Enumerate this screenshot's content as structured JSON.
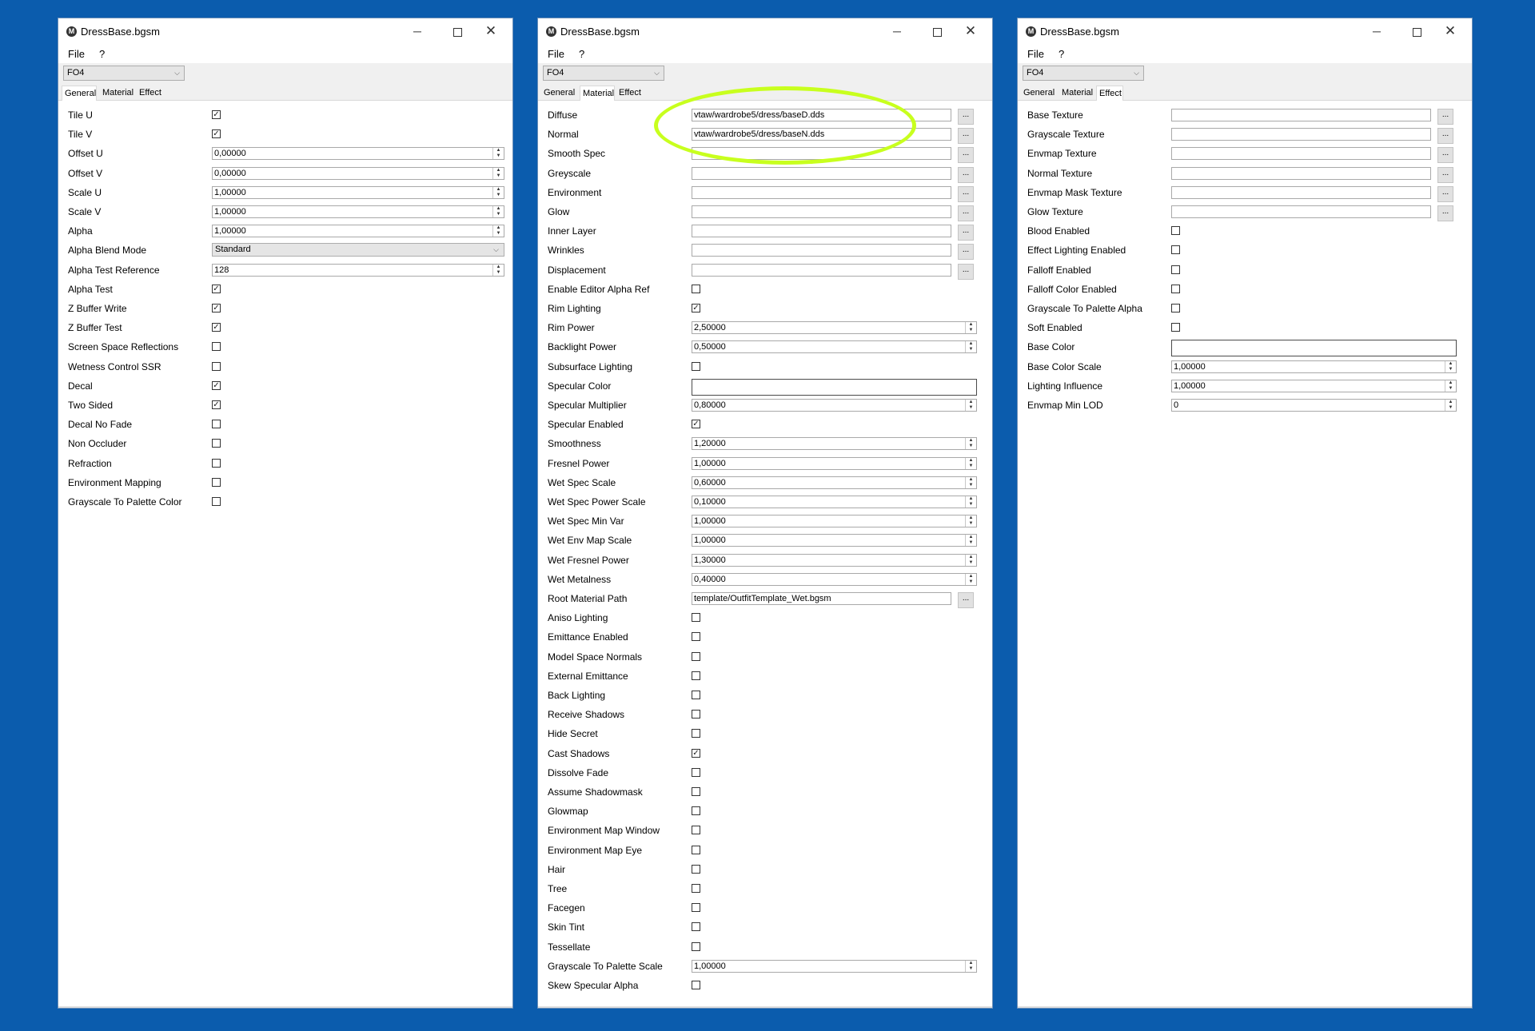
{
  "colors": {
    "desktop": "#0b5cad",
    "highlight": "#c8ff1e"
  },
  "windows": [
    {
      "title": "DressBase.bgsm",
      "icon": "M",
      "menu": [
        "File",
        "?"
      ],
      "game": "FO4",
      "tabs": [
        "General",
        "Material",
        "Effect"
      ],
      "active_tab": 0,
      "rows": [
        {
          "label": "Tile U",
          "type": "check",
          "checked": true
        },
        {
          "label": "Tile V",
          "type": "check",
          "checked": true
        },
        {
          "label": "Offset U",
          "type": "spin",
          "value": "0,00000"
        },
        {
          "label": "Offset V",
          "type": "spin",
          "value": "0,00000"
        },
        {
          "label": "Scale U",
          "type": "spin",
          "value": "1,00000"
        },
        {
          "label": "Scale V",
          "type": "spin",
          "value": "1,00000"
        },
        {
          "label": "Alpha",
          "type": "spin",
          "value": "1,00000"
        },
        {
          "label": "Alpha Blend Mode",
          "type": "select",
          "value": "Standard"
        },
        {
          "label": "Alpha Test Reference",
          "type": "spin",
          "value": "128"
        },
        {
          "label": "Alpha Test",
          "type": "check",
          "checked": true
        },
        {
          "label": "Z Buffer Write",
          "type": "check",
          "checked": true
        },
        {
          "label": "Z Buffer Test",
          "type": "check",
          "checked": true
        },
        {
          "label": "Screen Space Reflections",
          "type": "check",
          "checked": false
        },
        {
          "label": "Wetness Control SSR",
          "type": "check",
          "checked": false
        },
        {
          "label": "Decal",
          "type": "check",
          "checked": true
        },
        {
          "label": "Two Sided",
          "type": "check",
          "checked": true
        },
        {
          "label": "Decal No Fade",
          "type": "check",
          "checked": false
        },
        {
          "label": "Non Occluder",
          "type": "check",
          "checked": false
        },
        {
          "label": "Refraction",
          "type": "check",
          "checked": false
        },
        {
          "label": "Environment Mapping",
          "type": "check",
          "checked": false
        },
        {
          "label": "Grayscale To Palette Color",
          "type": "check",
          "checked": false
        }
      ]
    },
    {
      "title": "DressBase.bgsm",
      "icon": "M",
      "menu": [
        "File",
        "?"
      ],
      "game": "FO4",
      "tabs": [
        "General",
        "Material",
        "Effect"
      ],
      "active_tab": 1,
      "rows": [
        {
          "label": "Diffuse",
          "type": "path",
          "value": "vtaw/wardrobe5/dress/baseD.dds"
        },
        {
          "label": "Normal",
          "type": "path",
          "value": "vtaw/wardrobe5/dress/baseN.dds"
        },
        {
          "label": "Smooth Spec",
          "type": "path",
          "value": ""
        },
        {
          "label": "Greyscale",
          "type": "path",
          "value": ""
        },
        {
          "label": "Environment",
          "type": "path",
          "value": ""
        },
        {
          "label": "Glow",
          "type": "path",
          "value": ""
        },
        {
          "label": "Inner Layer",
          "type": "path",
          "value": ""
        },
        {
          "label": "Wrinkles",
          "type": "path",
          "value": ""
        },
        {
          "label": "Displacement",
          "type": "path",
          "value": ""
        },
        {
          "label": "Enable Editor Alpha Ref",
          "type": "check",
          "checked": false
        },
        {
          "label": "Rim Lighting",
          "type": "check",
          "checked": true
        },
        {
          "label": "Rim Power",
          "type": "spin",
          "value": "2,50000"
        },
        {
          "label": "Backlight Power",
          "type": "spin",
          "value": "0,50000"
        },
        {
          "label": "Subsurface Lighting",
          "type": "check",
          "checked": false
        },
        {
          "label": "Specular Color",
          "type": "color",
          "value": ""
        },
        {
          "label": "Specular Multiplier",
          "type": "spin",
          "value": "0,80000"
        },
        {
          "label": "Specular Enabled",
          "type": "check",
          "checked": true
        },
        {
          "label": "Smoothness",
          "type": "spin",
          "value": "1,20000"
        },
        {
          "label": "Fresnel Power",
          "type": "spin",
          "value": "1,00000"
        },
        {
          "label": "Wet Spec Scale",
          "type": "spin",
          "value": "0,60000"
        },
        {
          "label": "Wet Spec Power Scale",
          "type": "spin",
          "value": "0,10000"
        },
        {
          "label": "Wet Spec Min Var",
          "type": "spin",
          "value": "1,00000"
        },
        {
          "label": "Wet Env Map Scale",
          "type": "spin",
          "value": "1,00000"
        },
        {
          "label": "Wet Fresnel Power",
          "type": "spin",
          "value": "1,30000"
        },
        {
          "label": "Wet Metalness",
          "type": "spin",
          "value": "0,40000"
        },
        {
          "label": "Root Material Path",
          "type": "path",
          "value": "template/OutfitTemplate_Wet.bgsm"
        },
        {
          "label": "Aniso Lighting",
          "type": "check",
          "checked": false
        },
        {
          "label": "Emittance Enabled",
          "type": "check",
          "checked": false
        },
        {
          "label": "Model Space Normals",
          "type": "check",
          "checked": false
        },
        {
          "label": "External Emittance",
          "type": "check",
          "checked": false
        },
        {
          "label": "Back Lighting",
          "type": "check",
          "checked": false
        },
        {
          "label": "Receive Shadows",
          "type": "check",
          "checked": false
        },
        {
          "label": "Hide Secret",
          "type": "check",
          "checked": false
        },
        {
          "label": "Cast Shadows",
          "type": "check",
          "checked": true
        },
        {
          "label": "Dissolve Fade",
          "type": "check",
          "checked": false
        },
        {
          "label": "Assume Shadowmask",
          "type": "check",
          "checked": false
        },
        {
          "label": "Glowmap",
          "type": "check",
          "checked": false
        },
        {
          "label": "Environment Map Window",
          "type": "check",
          "checked": false
        },
        {
          "label": "Environment Map Eye",
          "type": "check",
          "checked": false
        },
        {
          "label": "Hair",
          "type": "check",
          "checked": false
        },
        {
          "label": "Tree",
          "type": "check",
          "checked": false
        },
        {
          "label": "Facegen",
          "type": "check",
          "checked": false
        },
        {
          "label": "Skin Tint",
          "type": "check",
          "checked": false
        },
        {
          "label": "Tessellate",
          "type": "check",
          "checked": false
        },
        {
          "label": "Grayscale To Palette Scale",
          "type": "spin",
          "value": "1,00000"
        },
        {
          "label": "Skew Specular Alpha",
          "type": "check",
          "checked": false
        }
      ]
    },
    {
      "title": "DressBase.bgsm",
      "icon": "M",
      "menu": [
        "File",
        "?"
      ],
      "game": "FO4",
      "tabs": [
        "General",
        "Material",
        "Effect"
      ],
      "active_tab": 2,
      "rows": [
        {
          "label": "Base Texture",
          "type": "path",
          "value": ""
        },
        {
          "label": "Grayscale Texture",
          "type": "path",
          "value": ""
        },
        {
          "label": "Envmap Texture",
          "type": "path",
          "value": ""
        },
        {
          "label": "Normal Texture",
          "type": "path",
          "value": ""
        },
        {
          "label": "Envmap Mask Texture",
          "type": "path",
          "value": ""
        },
        {
          "label": "Glow Texture",
          "type": "path",
          "value": ""
        },
        {
          "label": "Blood Enabled",
          "type": "check",
          "checked": false
        },
        {
          "label": "Effect Lighting Enabled",
          "type": "check",
          "checked": false
        },
        {
          "label": "Falloff Enabled",
          "type": "check",
          "checked": false
        },
        {
          "label": "Falloff Color Enabled",
          "type": "check",
          "checked": false
        },
        {
          "label": "Grayscale To Palette Alpha",
          "type": "check",
          "checked": false
        },
        {
          "label": "Soft Enabled",
          "type": "check",
          "checked": false
        },
        {
          "label": "Base Color",
          "type": "color",
          "value": ""
        },
        {
          "label": "Base Color Scale",
          "type": "spin",
          "value": "1,00000"
        },
        {
          "label": "Lighting Influence",
          "type": "spin",
          "value": "1,00000"
        },
        {
          "label": "Envmap Min LOD",
          "type": "spin",
          "value": "0"
        }
      ]
    }
  ],
  "icons": {
    "minimize": "─",
    "close": "✕",
    "check": "✓",
    "dropdown": "⌵",
    "spin_up": "▲",
    "spin_down": "▼",
    "browse": "..."
  }
}
